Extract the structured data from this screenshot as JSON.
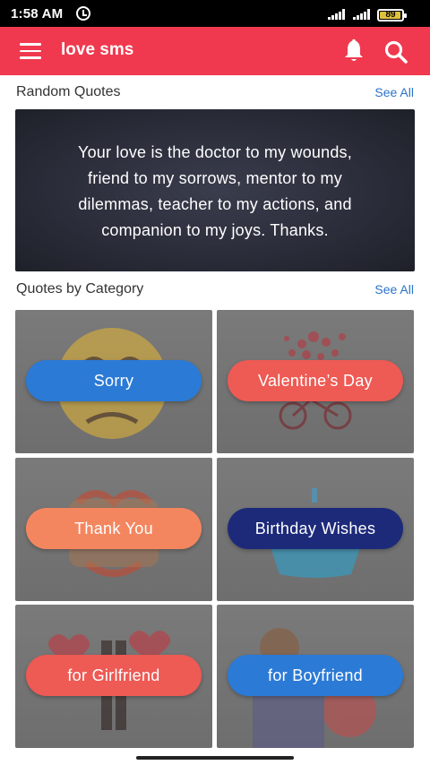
{
  "status_bar": {
    "time": "1:58 AM",
    "battery": "89"
  },
  "app_bar": {
    "title": "love sms"
  },
  "random_quotes": {
    "title": "Random Quotes",
    "see_all": "See All",
    "quote_lines": [
      "Your love is the doctor to my wounds,",
      "friend to my sorrows, mentor to my",
      "dilemmas, teacher to my actions, and",
      "companion to my joys. Thanks."
    ]
  },
  "categories": {
    "title": "Quotes by Category",
    "see_all": "See All",
    "items": [
      {
        "label": "Sorry",
        "color": "#2b7ad6"
      },
      {
        "label": "Valentine’s Day",
        "color": "#ee5a54"
      },
      {
        "label": "Thank You",
        "color": "#f4865f"
      },
      {
        "label": "Birthday Wishes",
        "color": "#1d2a7a"
      },
      {
        "label": "for Girlfriend",
        "color": "#ee5a54"
      },
      {
        "label": "for Boyfriend",
        "color": "#2b7ad6"
      }
    ]
  },
  "colors": {
    "app_bar": "#f0394e",
    "link": "#2b74c9"
  }
}
